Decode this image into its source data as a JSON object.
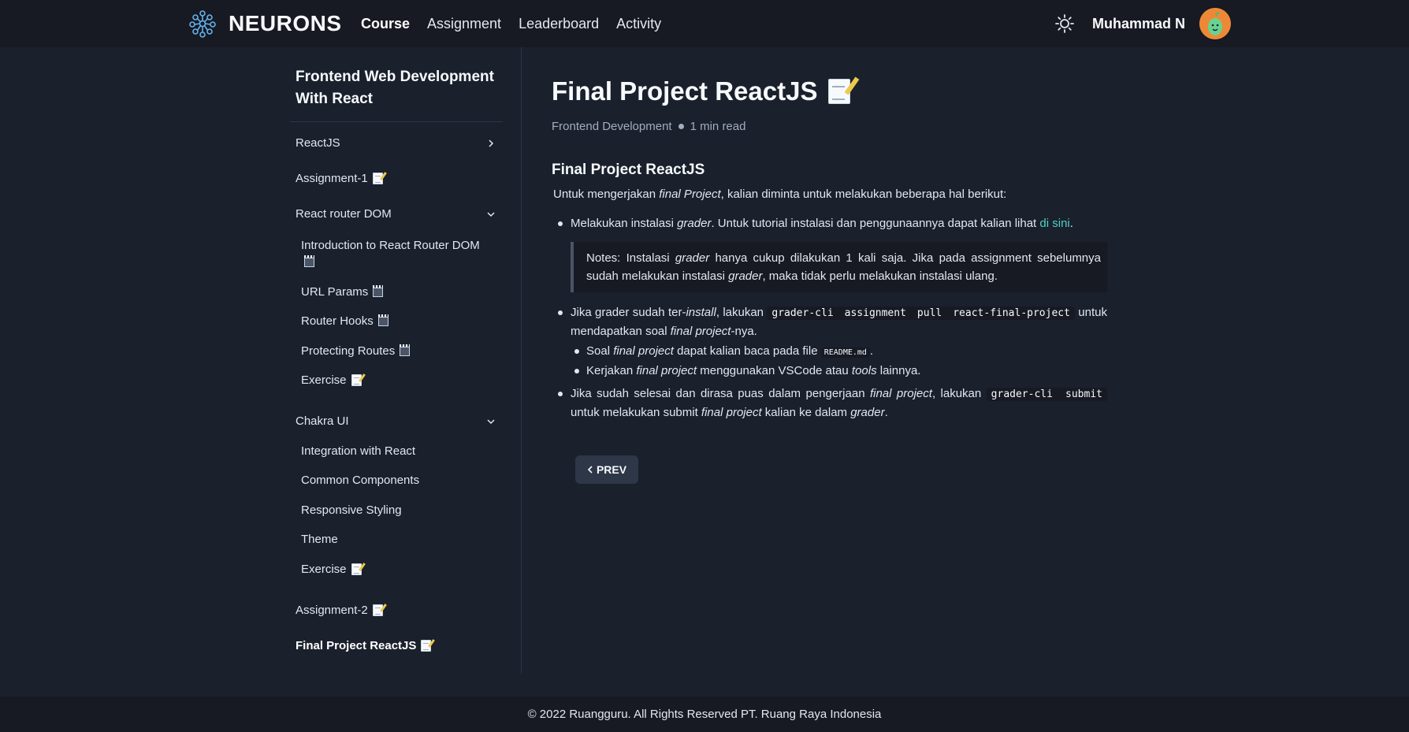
{
  "header": {
    "brand": "NEURONS",
    "nav": [
      "Course",
      "Assignment",
      "Leaderboard",
      "Activity"
    ],
    "active_nav": "Course",
    "user_name": "Muhammad N"
  },
  "sidebar": {
    "course_title": "Frontend Web Development With React",
    "items": [
      {
        "label": "ReactJS",
        "icon": "chevron-right-icon"
      },
      {
        "label": "Assignment-1",
        "icon": "memo-icon"
      },
      {
        "label": "React router DOM",
        "icon": "chevron-down-icon"
      },
      {
        "label": "Introduction to React Router DOM",
        "icon": "clapper-icon"
      },
      {
        "label": "URL Params",
        "icon": "clapper-icon"
      },
      {
        "label": "Router Hooks",
        "icon": "clapper-icon"
      },
      {
        "label": "Protecting Routes",
        "icon": "clapper-icon"
      },
      {
        "label": "Exercise",
        "icon": "memo-icon"
      },
      {
        "label": "Chakra UI",
        "icon": "chevron-down-icon"
      },
      {
        "label": "Integration with React"
      },
      {
        "label": "Common Components"
      },
      {
        "label": "Responsive Styling"
      },
      {
        "label": "Theme"
      },
      {
        "label": "Exercise",
        "icon": "memo-icon"
      },
      {
        "label": "Assignment-2",
        "icon": "memo-icon"
      },
      {
        "label": "Final Project ReactJS",
        "icon": "memo-icon"
      }
    ]
  },
  "main": {
    "title": "Final Project ReactJS",
    "category": "Frontend Development",
    "read_time": "1 min read",
    "section_title": "Final Project ReactJS",
    "intro_pre": "Untuk mengerjakan ",
    "intro_em": "final Project",
    "intro_post": ", kalian diminta untuk melakukan beberapa hal berikut:",
    "b1_pre": "Melakukan instalasi ",
    "b1_em": "grader",
    "b1_mid": ". Untuk tutorial instalasi dan penggunaannya dapat kalian lihat ",
    "b1_link": "di sini",
    "b1_post": ".",
    "note_pre": "Notes: Instalasi ",
    "note_em1": "grader",
    "note_mid": " hanya cukup dilakukan 1 kali saja. Jika pada assignment sebelumnya sudah melakukan instalasi ",
    "note_em2": "grader",
    "note_post": ", maka tidak perlu melakukan instalasi ulang.",
    "b2_pre": "Jika grader sudah ter-",
    "b2_em1": "install",
    "b2_mid": ", lakukan ",
    "b2_code": "grader-cli assignment pull react-final-project",
    "b2_mid2": " untuk mendapatkan soal ",
    "b2_em2": "final project",
    "b2_post": "-nya.",
    "s1_pre": "Soal ",
    "s1_em": "final project",
    "s1_mid": " dapat kalian baca pada file ",
    "s1_code": "README.md",
    "s1_post": ".",
    "s2_pre": "Kerjakan ",
    "s2_em1": "final project",
    "s2_mid": " menggunakan VSCode atau ",
    "s2_em2": "tools",
    "s2_post": " lainnya.",
    "b3_pre": "Jika sudah selesai dan dirasa puas dalam pengerjaan ",
    "b3_em1": "final project",
    "b3_mid": ", lakukan ",
    "b3_code": "grader-cli submit",
    "b3_mid2": " untuk melakukan submit ",
    "b3_em2": "final project",
    "b3_mid3": " kalian ke dalam ",
    "b3_em3": "grader",
    "b3_post": ".",
    "prev_label": "PREV"
  },
  "footer": {
    "text": "© 2022 Ruangguru. All Rights Reserved PT. Ruang Raya Indonesia"
  },
  "colors": {
    "background": "#1a202c",
    "header": "#171923",
    "link": "#4fd1c5",
    "avatar": "#ed8936"
  }
}
